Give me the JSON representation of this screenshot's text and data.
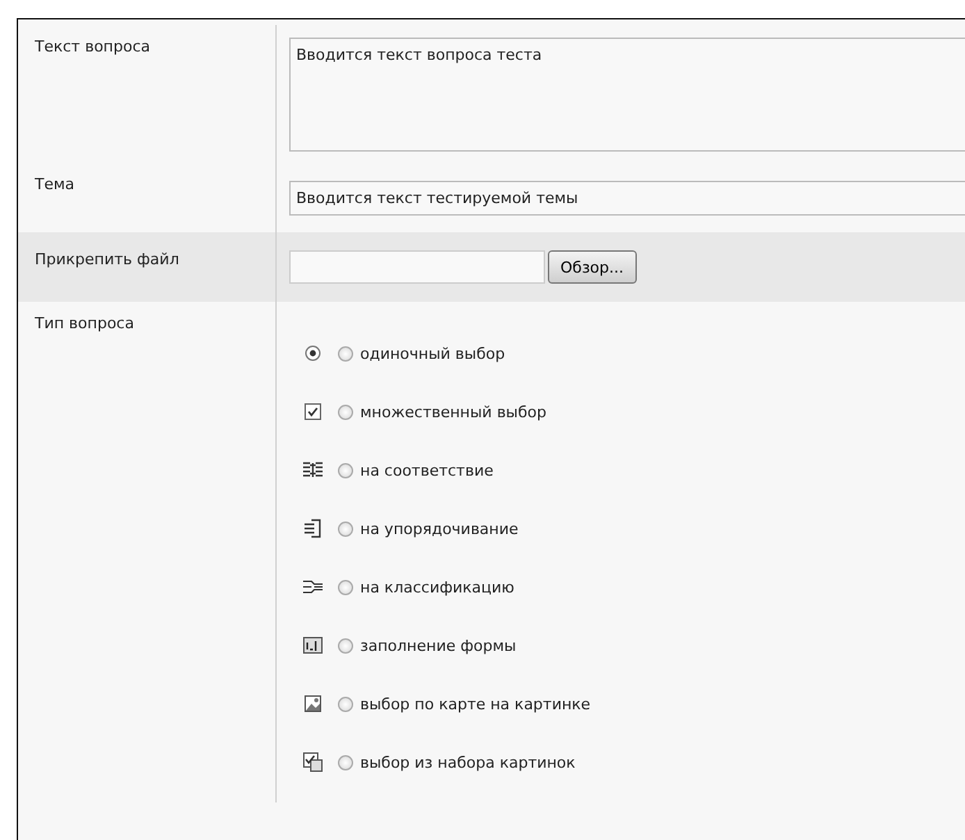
{
  "form": {
    "rows": [
      {
        "kind": "textarea",
        "label": "Текст вопроса",
        "value": "Вводится текст вопроса теста"
      },
      {
        "kind": "input",
        "label": "Тема",
        "value": "Вводится текст тестируемой темы"
      },
      {
        "kind": "file",
        "label": "Прикрепить файл",
        "button": "Обзор..."
      },
      {
        "kind": "options",
        "label": "Тип вопроса",
        "options": [
          {
            "kind": "single",
            "label": "одиночный выбор",
            "selected": false
          },
          {
            "kind": "multiple",
            "label": "множественный выбор",
            "selected": false
          },
          {
            "kind": "matching",
            "label": "на соответствие",
            "selected": false
          },
          {
            "kind": "ordering",
            "label": "на упорядочивание",
            "selected": false
          },
          {
            "kind": "classification",
            "label": "на классификацию",
            "selected": false
          },
          {
            "kind": "fill",
            "label": "заполнение формы",
            "selected": false
          },
          {
            "kind": "imagemap",
            "label": "выбор по карте на картинке",
            "selected": false
          },
          {
            "kind": "imageset",
            "label": "выбор из набора картинок",
            "selected": false
          }
        ]
      }
    ]
  }
}
